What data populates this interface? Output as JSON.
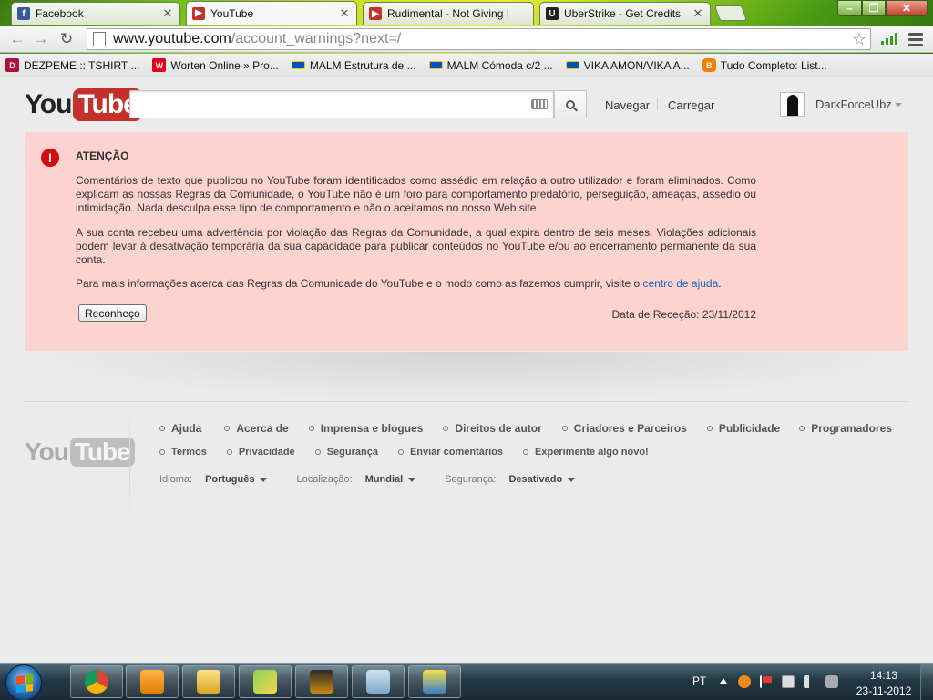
{
  "browser": {
    "tabs": [
      {
        "title": "Facebook",
        "favicon": "facebook-icon",
        "color": "#3b5998"
      },
      {
        "title": "YouTube",
        "favicon": "youtube-icon",
        "color": "#c4302b",
        "active": true
      },
      {
        "title": "Rudimental - Not Giving I",
        "favicon": "youtube-icon",
        "color": "#c4302b"
      },
      {
        "title": "UberStrike - Get Credits",
        "favicon": "uberstrike-icon",
        "color": "#222222"
      }
    ],
    "url_host": "www.youtube.com",
    "url_path": "/account_warnings?next=/",
    "bookmarks": [
      {
        "label": "DEZPEME :: TSHIRT ...",
        "icon": "dezpeme-icon",
        "color": "#b0103a"
      },
      {
        "label": "Worten Online » Pro...",
        "icon": "worten-icon",
        "color": "#e2001a"
      },
      {
        "label": "MALM Estrutura de ...",
        "icon": "ikea-icon",
        "color": "#0051ba"
      },
      {
        "label": "MALM Cómoda c/2 ...",
        "icon": "ikea-icon",
        "color": "#0051ba"
      },
      {
        "label": "VIKA AMON/VIKA A...",
        "icon": "ikea-icon",
        "color": "#0051ba"
      },
      {
        "label": "Tudo Completo: List...",
        "icon": "blogger-icon",
        "color": "#f57d00"
      }
    ]
  },
  "header": {
    "logo_you": "You",
    "logo_tube": "Tube",
    "nav_browse": "Navegar",
    "nav_upload": "Carregar",
    "username": "DarkForceUbz"
  },
  "warning": {
    "title": "ATENÇÃO",
    "p1": "Comentários de texto que publicou no YouTube foram identificados como assédio em relação a outro utilizador e foram eliminados. Como explicam as nossas Regras da Comunidade, o YouTube não é um foro para comportamento predatório, perseguição, ameaças, assédio ou intimidação. Nada desculpa esse tipo de comportamento e não o aceitamos no nosso Web site.",
    "p2": "A sua conta recebeu uma advertência por violação das Regras da Comunidade, a qual expira dentro de seis meses. Violações adicionais podem levar à desativação temporária da sua capacidade para publicar conteúdos no YouTube e/ou ao encerramento permanente da sua conta.",
    "p3_prefix": "Para mais informações acerca das Regras da Comunidade do YouTube e o modo como as fazemos cumprir, visite o ",
    "p3_link": "centro de ajuda",
    "p3_suffix": ".",
    "ack_button": "Reconheço",
    "received": "Data de Receção: 23/11/2012"
  },
  "footer": {
    "links_row1": [
      "Ajuda",
      "Acerca de",
      "Imprensa e blogues",
      "Direitos de autor",
      "Criadores e Parceiros",
      "Publicidade",
      "Programadores"
    ],
    "links_row2": [
      "Termos",
      "Privacidade",
      "Segurança",
      "Enviar comentários",
      "Experimente algo novo!"
    ],
    "language_label": "Idioma:",
    "language_value": "Português",
    "location_label": "Localização:",
    "location_value": "Mundial",
    "safety_label": "Segurança:",
    "safety_value": "Desativado"
  },
  "taskbar": {
    "language": "PT",
    "time": "14:13",
    "date": "23-11-2012"
  }
}
